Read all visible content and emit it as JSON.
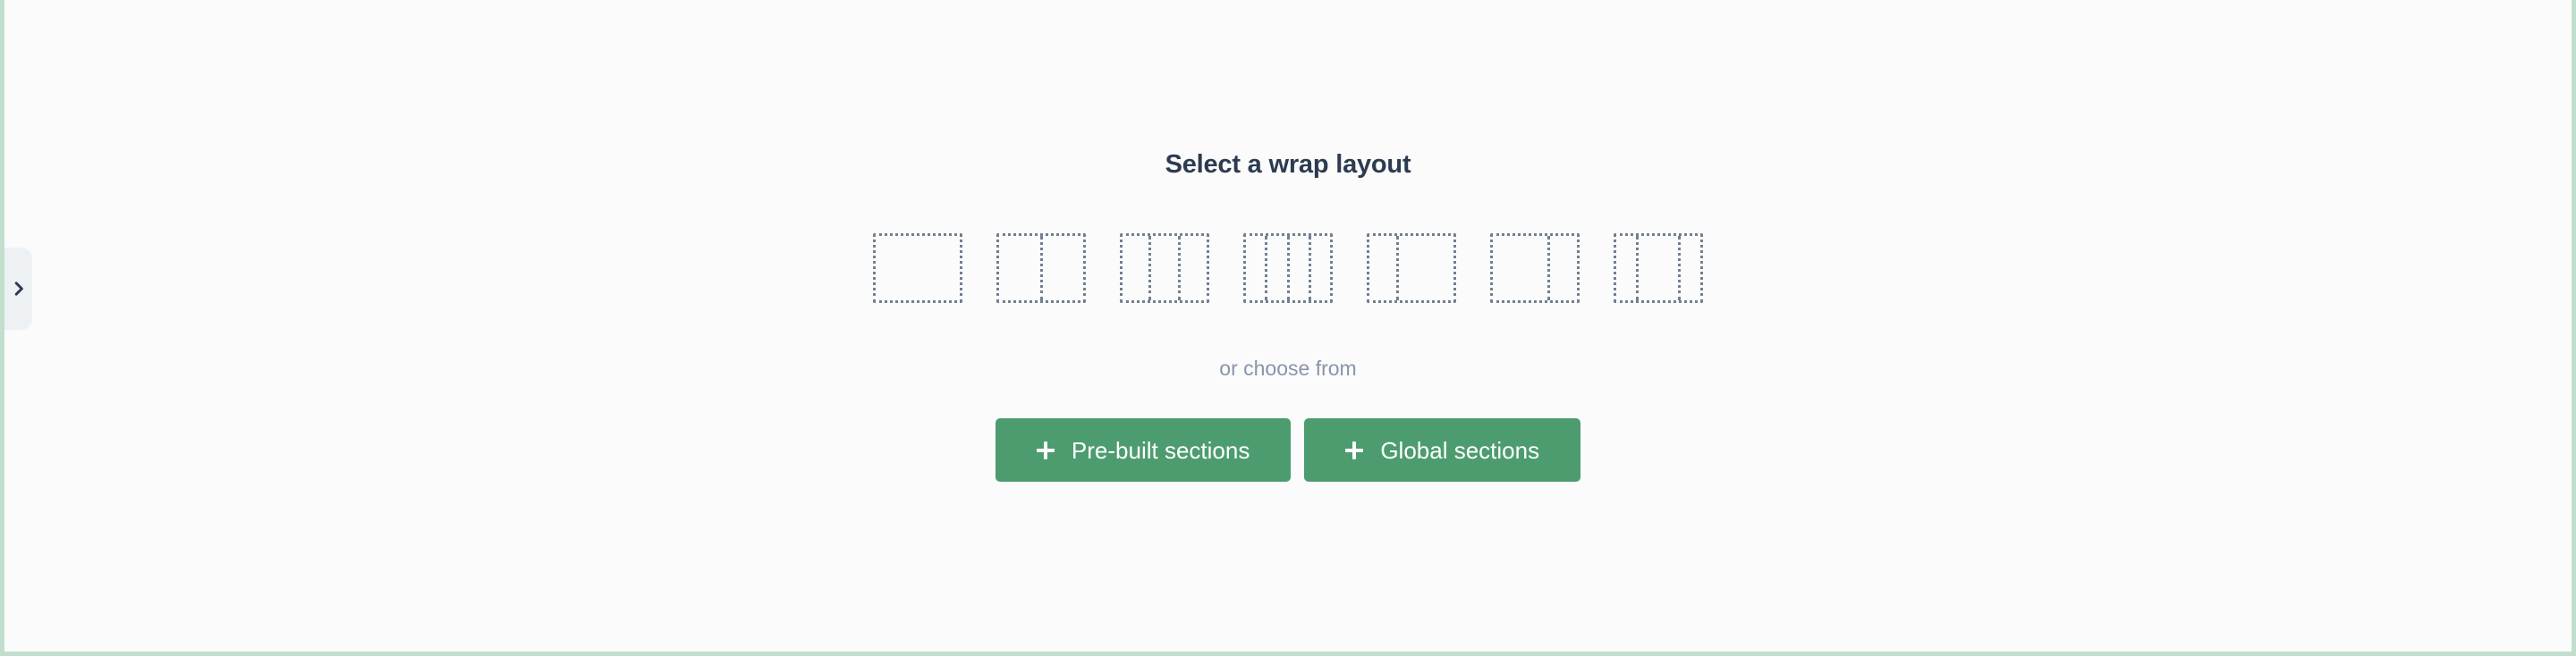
{
  "canvas": {
    "background_color": "#fbfbfb",
    "border_color": "#c2dfce"
  },
  "panel_handle": {
    "icon": "chevron-right-icon",
    "background_color": "#edf1f3",
    "icon_color": "#2d3b4e"
  },
  "wrap_picker": {
    "title": "Select a wrap layout",
    "title_color": "#2d3b50",
    "divider_text": "or choose from",
    "divider_text_color": "#8a94ab",
    "outline_color": "#717f92",
    "options": [
      {
        "name": "1 column",
        "columns": [
          1
        ]
      },
      {
        "name": "2 equal columns",
        "columns": [
          1,
          1
        ]
      },
      {
        "name": "3 equal columns",
        "columns": [
          1,
          1,
          1
        ]
      },
      {
        "name": "4 equal columns",
        "columns": [
          1,
          1,
          1,
          1
        ]
      },
      {
        "name": "1/3 + 2/3 columns",
        "columns": [
          1,
          2
        ]
      },
      {
        "name": "2/3 + 1/3 columns",
        "columns": [
          2,
          1
        ]
      },
      {
        "name": "1/4 + 1/2 + 1/4 columns",
        "columns": [
          1,
          2,
          1
        ]
      }
    ]
  },
  "actions": {
    "accent_color": "#4c9c6f",
    "buttons": [
      {
        "label": "Pre-built sections",
        "icon": "plus-icon"
      },
      {
        "label": "Global sections",
        "icon": "plus-icon"
      }
    ]
  }
}
